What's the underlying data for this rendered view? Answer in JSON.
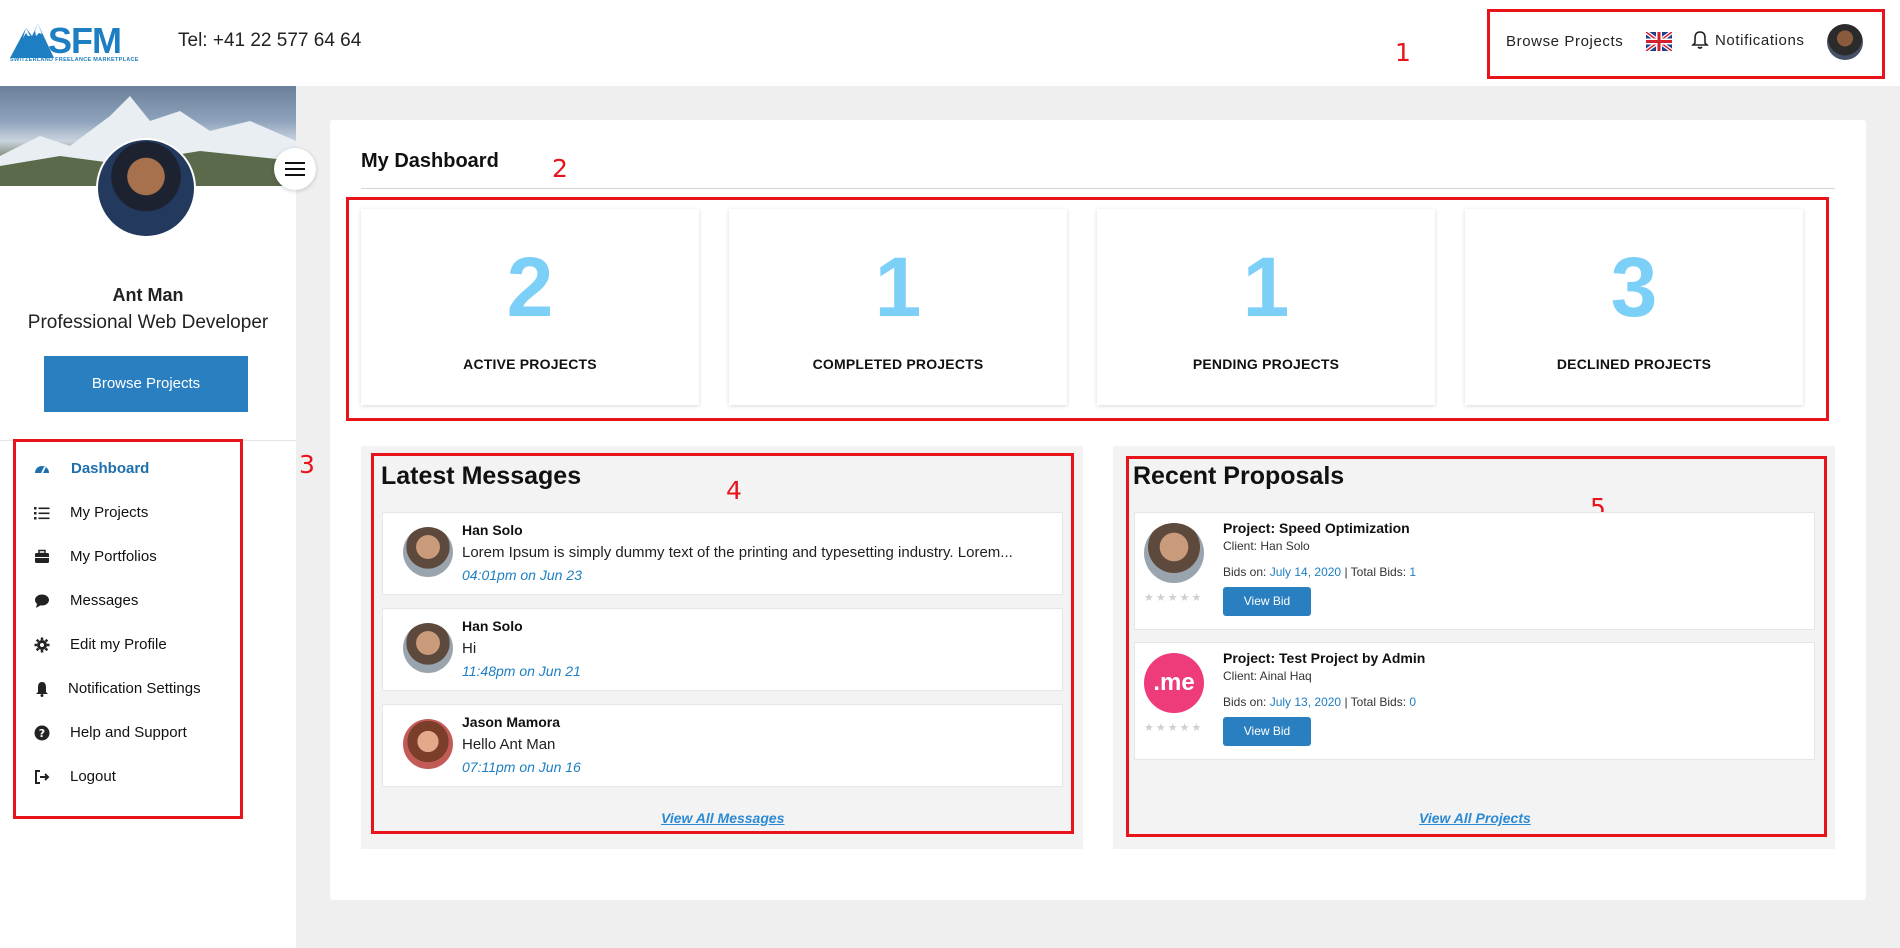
{
  "header": {
    "logo_text": "SFM",
    "logo_tagline": "SWITZERLAND FREELANCE MARKETPLACE",
    "tel": "Tel: +41 22 577 64 64",
    "browse_projects": "Browse Projects",
    "notifications": "Notifications"
  },
  "annotations": {
    "a1": "1",
    "a2": "2",
    "a3": "3",
    "a4": "4",
    "a5": "5"
  },
  "profile": {
    "name": "Ant Man",
    "title": "Professional Web Developer",
    "browse_button": "Browse Projects"
  },
  "nav": {
    "items": [
      {
        "label": "Dashboard",
        "icon": "dashboard-icon",
        "active": true
      },
      {
        "label": "My Projects",
        "icon": "list-icon"
      },
      {
        "label": "My Portfolios",
        "icon": "briefcase-icon"
      },
      {
        "label": "Messages",
        "icon": "chat-icon"
      },
      {
        "label": "Edit my Profile",
        "icon": "gear-icon"
      },
      {
        "label": "Notification Settings",
        "icon": "bell-icon"
      },
      {
        "label": "Help and Support",
        "icon": "question-icon"
      },
      {
        "label": "Logout",
        "icon": "logout-icon"
      }
    ]
  },
  "dashboard": {
    "title": "My Dashboard",
    "stats": [
      {
        "value": "2",
        "label": "ACTIVE PROJECTS"
      },
      {
        "value": "1",
        "label": "COMPLETED PROJECTS"
      },
      {
        "value": "1",
        "label": "PENDING PROJECTS"
      },
      {
        "value": "3",
        "label": "DECLINED PROJECTS"
      }
    ]
  },
  "messages": {
    "title": "Latest Messages",
    "items": [
      {
        "name": "Han Solo",
        "text": "Lorem Ipsum is simply dummy text of the printing and typesetting industry. Lorem...",
        "time": "04:01pm on Jun 23"
      },
      {
        "name": "Han Solo",
        "text": "Hi",
        "time": "11:48pm on Jun 21"
      },
      {
        "name": "Jason Mamora",
        "text": "Hello Ant Man",
        "time": "07:11pm on Jun 16"
      }
    ],
    "view_all": "View All Messages"
  },
  "proposals": {
    "title": "Recent Proposals",
    "items": [
      {
        "project": "Project: Speed Optimization",
        "client": "Client: Han Solo",
        "bids_on_label": "Bids on:",
        "bids_on": "July 14, 2020",
        "total_label": "| Total Bids:",
        "total": "1",
        "button": "View Bid"
      },
      {
        "project": "Project: Test Project by Admin",
        "client": "Client: Ainal Haq",
        "bids_on_label": "Bids on:",
        "bids_on": "July 13, 2020",
        "total_label": "| Total Bids:",
        "total": "0",
        "button": "View Bid",
        "logo_text": ".me"
      }
    ],
    "stars": "★★★★★",
    "view_all": "View All Projects"
  },
  "colors": {
    "accent": "#2a7fc0",
    "stat_number": "#7ccff6",
    "annotation": "#e8131b"
  }
}
